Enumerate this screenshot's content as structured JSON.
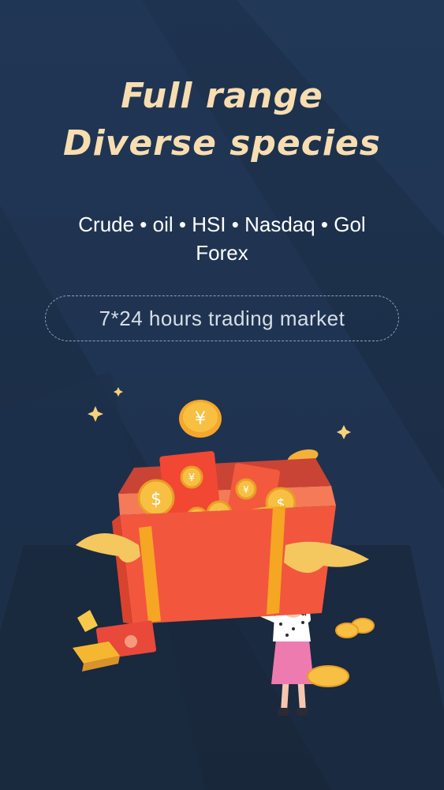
{
  "headline": {
    "line1": "Full range",
    "line2": "Diverse species"
  },
  "markets": {
    "line1": "Crude • oil • HSI • Nasdaq • Gol",
    "line2": "Forex"
  },
  "badge": {
    "label": "7*24 hours trading market"
  },
  "colors": {
    "background": "#1b2d45",
    "headline": "#f7ddb0",
    "gift_box": "#f2573e",
    "coin": "#f5b531"
  },
  "illustration": {
    "icons": [
      "gift-box",
      "coin-yen",
      "coin-dollar",
      "red-envelope",
      "gold-bar",
      "sparkle",
      "woman"
    ]
  }
}
